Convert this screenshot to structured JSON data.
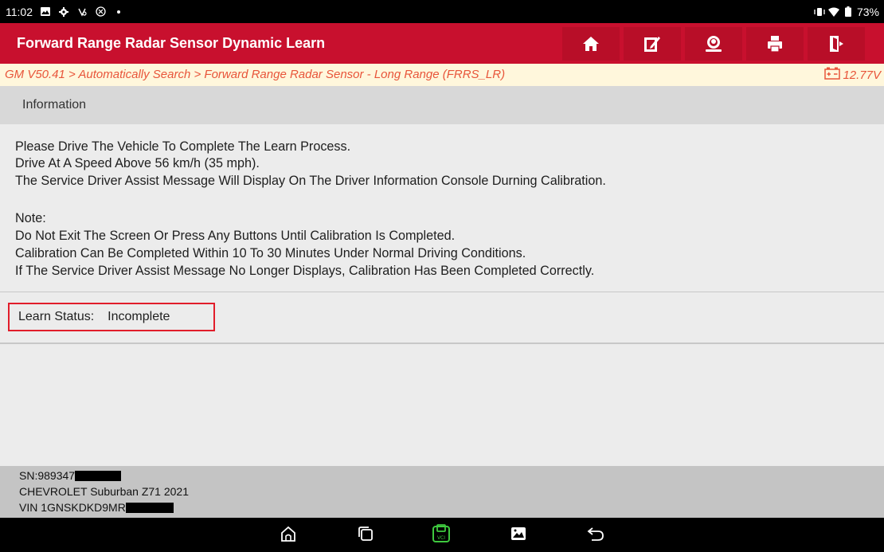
{
  "status_bar": {
    "time": "11:02",
    "battery": "73%",
    "left_icons": [
      "gallery-icon",
      "settings-icon",
      "vpn-icon",
      "nfc-icon",
      "dot-icon"
    ],
    "right_icons": [
      "vibrate-icon",
      "wifi-icon",
      "battery-icon"
    ]
  },
  "header": {
    "title": "Forward Range Radar Sensor Dynamic Learn",
    "accent_color": "#c8102e",
    "buttons": [
      "home-icon",
      "edit-report-icon",
      "remote-support-icon",
      "print-icon",
      "exit-icon"
    ]
  },
  "breadcrumb": {
    "path": "GM V50.41 > Automatically Search > Forward Range Radar Sensor - Long Range (FRRS_LR)",
    "voltage": "12.77V",
    "color": "#e8553a"
  },
  "section": {
    "title": "Information"
  },
  "message": {
    "lines": [
      " Please Drive The Vehicle To Complete The Learn Process.",
      "Drive At A Speed Above 56 km/h (35 mph).",
      "The Service Driver Assist Message Will Display On The Driver Information Console Durning Calibration.",
      "Note:",
      "Do Not Exit The Screen Or Press Any Buttons Until Calibration Is Completed.",
      "Calibration Can Be Completed Within 10 To 30 Minutes Under Normal Driving Conditions.",
      "If The Service Driver Assist Message No Longer Displays, Calibration Has Been Completed Correctly."
    ]
  },
  "learn_status": {
    "label": "Learn Status:",
    "value": "Incomplete",
    "highlight_color": "#e11d2a"
  },
  "vehicle": {
    "serial": "SN:989347",
    "model": "CHEVROLET Suburban Z71 2021",
    "vin": "VIN 1GNSKDKD9MR"
  },
  "nav_bar": {
    "buttons": [
      "home-icon",
      "recents-icon",
      "vci-icon",
      "screenshot-icon",
      "back-icon"
    ],
    "vci_color": "#3ec93e"
  }
}
